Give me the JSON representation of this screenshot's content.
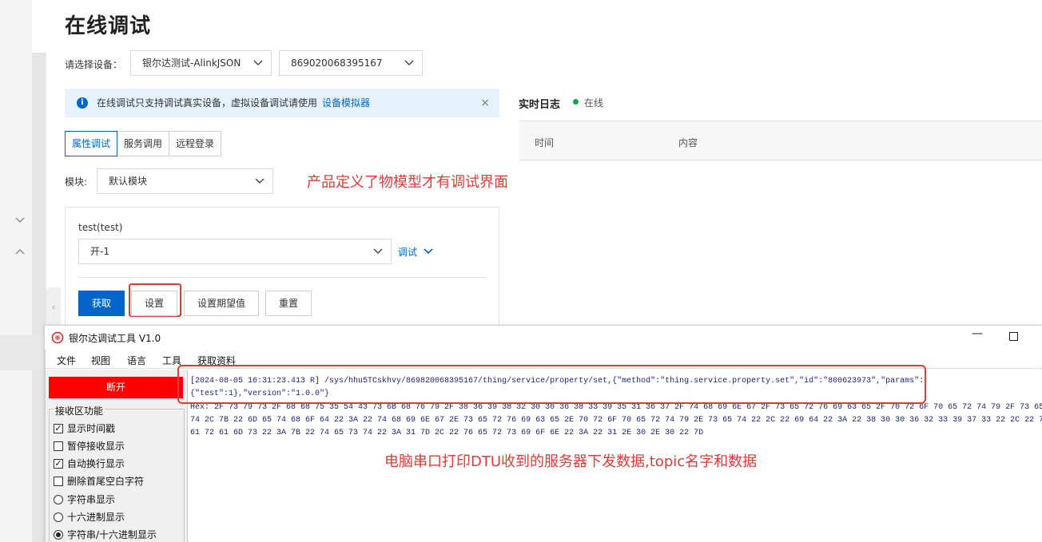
{
  "page": {
    "title": "在线调试",
    "device_select_label": "请选择设备：",
    "product_select": "银尔达测试-AlinkJSON",
    "device_select": "869020068395167"
  },
  "notice": {
    "text": "在线调试只支持调试真实设备，虚拟设备调试请使用",
    "link": "设备模拟器",
    "close": "×"
  },
  "tabs": [
    "属性调试",
    "服务调用",
    "远程登录"
  ],
  "module": {
    "label": "模块:",
    "value": "默认模块"
  },
  "annotation_top": "产品定义了物模型才有调试界面",
  "property": {
    "name": "test(test)",
    "value": "开-1",
    "debug_label": "调试"
  },
  "actions": {
    "get": "获取",
    "set": "设置",
    "set_expected": "设置期望值",
    "reset": "重置"
  },
  "realtime_log": {
    "title": "实时日志",
    "status": "在线",
    "columns": [
      "时间",
      "内容"
    ],
    "status_color": "#1aa055"
  },
  "serial_tool": {
    "title": "银尔达调试工具 V1.0",
    "menu": [
      "文件",
      "视图",
      "语言",
      "工具",
      "获取资料"
    ],
    "disconnect": "断开",
    "recv_group_title": "接收区功能",
    "options": [
      {
        "label": "显示时间戳",
        "type": "checkbox",
        "checked": true
      },
      {
        "label": "暂停接收显示",
        "type": "checkbox",
        "checked": false
      },
      {
        "label": "自动换行显示",
        "type": "checkbox",
        "checked": true
      },
      {
        "label": "删除首尾空白字符",
        "type": "checkbox",
        "checked": false
      },
      {
        "label": "字符串显示",
        "type": "radio",
        "checked": false
      },
      {
        "label": "十六进制显示",
        "type": "radio",
        "checked": false
      },
      {
        "label": "字符串/十六进制显示",
        "type": "radio",
        "checked": true
      }
    ],
    "recv_line1": "[2024-08-05 16:31:23.413 R] /sys/hhu5TCskhvy/869820068395167/thing/service/property/set,{\"method\":\"thing.service.property.set\",\"id\":\"800623973\",\"params\":",
    "recv_line2": "{\"test\":1},\"version\":\"1.0.0\"}",
    "hex_line1": "Hex: 2F 73 79 73 2F 68 68 75 35 54 43 73 6B 68 76 79 2F 38 36 39 38 32 30 30 36 38 33 39 35 31 36 37 2F 74 68 69 6E 67 2F 73 65 72 76 69 63 65 2F 70 72 6F 70 65 72 74 79 2F 73 65",
    "hex_line2": "74 2C 7B 22 6D 65 74 68 6F 64 22 3A 22 74 68 69 6E 67 2E 73 65 72 76 69 63 65 2E 70 72 6F 70 65 72 74 79 2E 73 65 74 22 2C 22 69 64 22 3A 22 38 30 30 36 32 33 39 37 33 22 2C 22 70",
    "hex_line3": "61 72 61 6D 73 22 3A 7B 22 74 65 73 74 22 3A 31 7D 2C 22 76 65 72 73 69 6F 6E 22 3A 22 31 2E 30 2E 30 22 7D"
  },
  "annotation_bottom": "电脑串口打印DTU收到的服务器下发数据,topic名字和数据",
  "colors": {
    "accent": "#0064c8",
    "annotation": "#e53935",
    "disconnect": "#ff0000"
  }
}
